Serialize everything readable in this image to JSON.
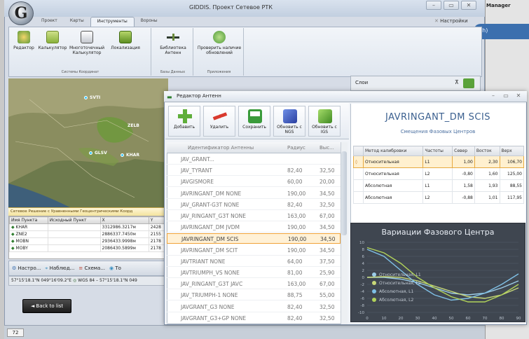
{
  "app": {
    "logo_letter": "G",
    "window_title": "GIDDIS. Проект Сетевое РТК",
    "settings_link": "Настройки",
    "sidebar_label": "Manager",
    "sidebar_hint": "sh)",
    "zoom_value": "72"
  },
  "ribbon": {
    "tabs": [
      "Проект",
      "Карты",
      "Инструменты",
      "Вороны"
    ],
    "active_tab": 2,
    "groups": [
      {
        "label": "Системы Координат",
        "buttons": [
          {
            "label": "Редактор",
            "icon": "editor-icon"
          },
          {
            "label": "Калькулятор",
            "icon": "calculator-icon"
          },
          {
            "label": "Многоточечный Калькулятор",
            "icon": "multipoint-calculator-icon"
          },
          {
            "label": "Локализация",
            "icon": "localization-icon"
          }
        ]
      },
      {
        "label": "Базы Данных",
        "buttons": [
          {
            "label": "Библиотека Антенн",
            "icon": "antenna-library-icon"
          }
        ]
      },
      {
        "label": "Приложения",
        "buttons": [
          {
            "label": "Проверить наличие обновлений",
            "icon": "check-updates-icon"
          }
        ]
      }
    ]
  },
  "layers": {
    "label": "Слои",
    "pin": "⊼"
  },
  "map": {
    "sites": [
      {
        "name": "SVTI"
      },
      {
        "name": "ZELB"
      },
      {
        "name": "GLSV"
      },
      {
        "name": "KHAR"
      }
    ]
  },
  "network": {
    "title": "Сетевое Решение с Уравненными Геоцентрическими Коорд",
    "columns": [
      "Имя Пункта",
      "Исходный Пункт",
      "X",
      "Y"
    ],
    "rows": [
      [
        "KHAR",
        "",
        "3312986.3217м",
        "2428"
      ],
      [
        "ZNE2",
        "",
        "2886337.7450м",
        "2155"
      ],
      [
        "MOBN",
        "",
        "2936433.9998м",
        "2178"
      ],
      [
        "MOBY",
        "",
        "2086430.5899м",
        "2178"
      ]
    ]
  },
  "bottom_bar": {
    "items": [
      "Настро...",
      "Наблюд...",
      "Схема...",
      "То"
    ]
  },
  "coords": {
    "left": "57°15'18.1\"N 049°16'09.2\"E",
    "crs": "WGS 84",
    "right": "57°15'18.1\"N 049"
  },
  "back_button": "◄ Back to list",
  "editor": {
    "title": "Редактор Антенн",
    "toolbar": [
      {
        "label": "Добавить",
        "icon": "add-icon",
        "color": "#5fae3a"
      },
      {
        "label": "Удалить",
        "icon": "delete-icon",
        "color": "#d93a2e"
      },
      {
        "label": "Сохранить",
        "icon": "save-icon",
        "color": "#3a9b3a"
      },
      {
        "label": "Обновить с NGS",
        "icon": "update-ngs-icon",
        "color": "#3b5fc9"
      },
      {
        "label": "Обновить с IGS",
        "icon": "update-igs-icon",
        "color": "#5ab23a"
      }
    ],
    "list_columns": [
      "Идентификатор Антенны",
      "Радиус",
      "Выс..."
    ],
    "antennas": [
      {
        "id": "JAV_GRANT...",
        "radius": "",
        "height": ""
      },
      {
        "id": "JAV_TYRANT",
        "radius": "82,40",
        "height": "32,50"
      },
      {
        "id": "JAVGISMORE",
        "radius": "60,00",
        "height": "20,00"
      },
      {
        "id": "JAVRINGANT_DM    NONE",
        "radius": "190,00",
        "height": "34,50"
      },
      {
        "id": "JAV_GRANT-G3T    NONE",
        "radius": "82,40",
        "height": "32,50"
      },
      {
        "id": "JAV_RINGANT_G3T NONE",
        "radius": "163,00",
        "height": "67,00"
      },
      {
        "id": "JAVRINGANT_DM    JVDM",
        "radius": "190,00",
        "height": "34,50"
      },
      {
        "id": "JAVRINGANT_DM    SCIS",
        "radius": "190,00",
        "height": "34,50"
      },
      {
        "id": "JAVRINGANT_DM    SCIT",
        "radius": "190,00",
        "height": "34,50"
      },
      {
        "id": "JAVTRIANT         NONE",
        "radius": "64,00",
        "height": "37,50"
      },
      {
        "id": "JAVTRIUMPH_VS   NONE",
        "radius": "81,00",
        "height": "25,90"
      },
      {
        "id": "JAV_RINGANT_G3T JAVC",
        "radius": "163,00",
        "height": "67,00"
      },
      {
        "id": "JAV_TRIUMPH-1   NONE",
        "radius": "88,75",
        "height": "55,00"
      },
      {
        "id": "JAVGRANT_G3      NONE",
        "radius": "82,40",
        "height": "32,50"
      },
      {
        "id": "JAVGRANT_G3+GP  NONE",
        "radius": "82,40",
        "height": "32,50"
      }
    ],
    "selected_index": 7,
    "detail": {
      "antenna": "JAVRINGANT_DM    SCIS",
      "subtitle": "Смещения Фазовых Центров",
      "columns": [
        "Метод калибровки",
        "Частоты",
        "Север",
        "Восток",
        "Верх"
      ],
      "rows": [
        [
          "Относительная",
          "L1",
          "1,00",
          "2,30",
          "106,70"
        ],
        [
          "Относительная",
          "L2",
          "-0,80",
          "1,60",
          "125,00"
        ],
        [
          "Абсолютная",
          "L1",
          "1,58",
          "1,93",
          "88,55"
        ],
        [
          "Абсолютная",
          "L2",
          "-0,88",
          "1,01",
          "117,95"
        ]
      ],
      "selected_row": 0
    }
  },
  "chart_data": {
    "type": "line",
    "title": "Вариации Фазового Центра",
    "x": [
      0,
      10,
      20,
      30,
      40,
      50,
      60,
      70,
      80,
      90
    ],
    "ylim": [
      -10,
      10
    ],
    "yticks": [
      10,
      8,
      6,
      4,
      2,
      0,
      -2,
      -4,
      -6,
      -8,
      -10
    ],
    "series": [
      {
        "name": "Относительная, L1",
        "color": "#9ccde8",
        "values": [
          0,
          0,
          -0.5,
          -1.5,
          -3,
          -4.5,
          -5,
          -4.5,
          -3,
          -1
        ]
      },
      {
        "name": "Относительная, L2",
        "color": "#c8d878",
        "values": [
          0,
          0.2,
          0,
          -1,
          -2.5,
          -4,
          -5.5,
          -6,
          -5,
          -3
        ]
      },
      {
        "name": "Абсолютная, L1",
        "color": "#7fc0e6",
        "values": [
          8,
          6,
          2,
          -2,
          -5,
          -6.5,
          -6,
          -4.5,
          -2,
          1
        ]
      },
      {
        "name": "Абсолютная, L2",
        "color": "#b2d35a",
        "values": [
          8.5,
          7,
          4,
          0,
          -3,
          -5.5,
          -7,
          -7,
          -5,
          -2
        ]
      }
    ]
  }
}
